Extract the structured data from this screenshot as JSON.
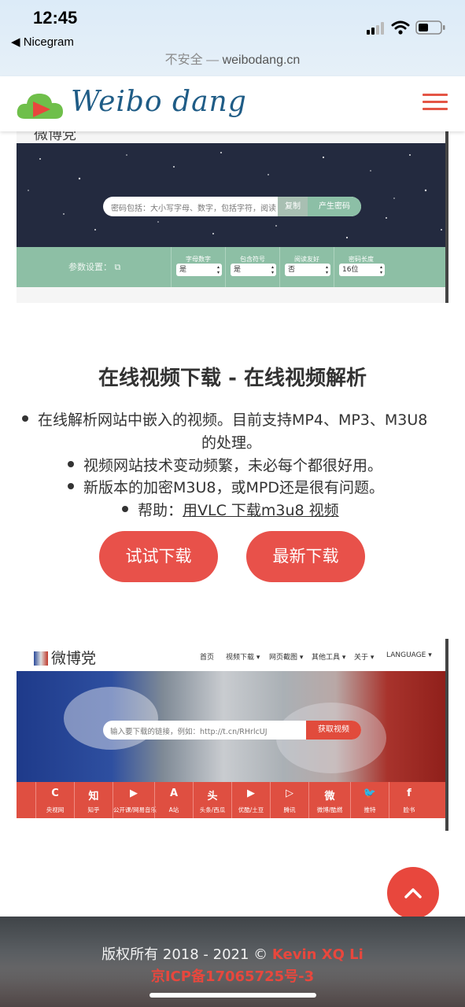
{
  "status_bar": {
    "time": "12:45",
    "back_app": "Nicegram"
  },
  "address_bar": {
    "insecure_label": "不安全 —",
    "domain": "weibodang.cn"
  },
  "header": {
    "logo_text": "Weibo dang"
  },
  "password_tool": {
    "partial_logo_text": "微博党",
    "input_placeholder": "密码包括：大小写字母、数字，包括字符，阅读",
    "copy_label": "复制",
    "generate_label": "产生密码",
    "settings_label": "参数设置：",
    "options": [
      {
        "label": "字母数字",
        "value": "是"
      },
      {
        "label": "包含符号",
        "value": "是"
      },
      {
        "label": "阅读友好",
        "value": "否"
      },
      {
        "label": "密码长度",
        "value": "16位"
      }
    ]
  },
  "section": {
    "title": "在线视频下载 - 在线视频解析",
    "bullets": [
      "在线解析网站中嵌入的视频。目前支持MP4、MP3、M3U8",
      "的处理。",
      "视频网站技术变动频繁，未必每个都很好用。",
      "新版本的加密M3U8，或MPD还是很有问题。"
    ],
    "help_prefix": "帮助：",
    "help_link": "用VLC 下载m3u8 视频",
    "try_button": "试试下载",
    "latest_button": "最新下载"
  },
  "downloader_preview": {
    "logo_text": "微博党",
    "menu": [
      "首页",
      "视频下载 ▾",
      "网页截图 ▾",
      "其他工具 ▾",
      "关于 ▾",
      "LANGUAGE ▾"
    ],
    "input_placeholder": "输入要下载的链接，例如：http://t.cn/RHrlcUJ",
    "fetch_button": "获取视频",
    "sites": [
      {
        "icon": "C",
        "name": "央视网"
      },
      {
        "icon": "知",
        "name": "知乎"
      },
      {
        "icon": "▶",
        "name": "公开课/网易音乐"
      },
      {
        "icon": "A",
        "name": "A站"
      },
      {
        "icon": "头",
        "name": "头条/西瓜"
      },
      {
        "icon": "▶",
        "name": "优酷/土豆"
      },
      {
        "icon": "▷",
        "name": "腾讯"
      },
      {
        "icon": "微",
        "name": "微博/酷燃"
      },
      {
        "icon": "🐦",
        "name": "推特"
      },
      {
        "icon": "f",
        "name": "脸书"
      }
    ]
  },
  "footer": {
    "copyright_prefix": "版权所有 2018 - 2021 ©",
    "author": "Kevin XQ Li",
    "icp": "京ICP备17065725号-3"
  },
  "colors": {
    "accent": "#e8514a",
    "brand_blue": "#1f5c86",
    "mint": "#8dbfa5",
    "footer_red": "#e8473d"
  }
}
